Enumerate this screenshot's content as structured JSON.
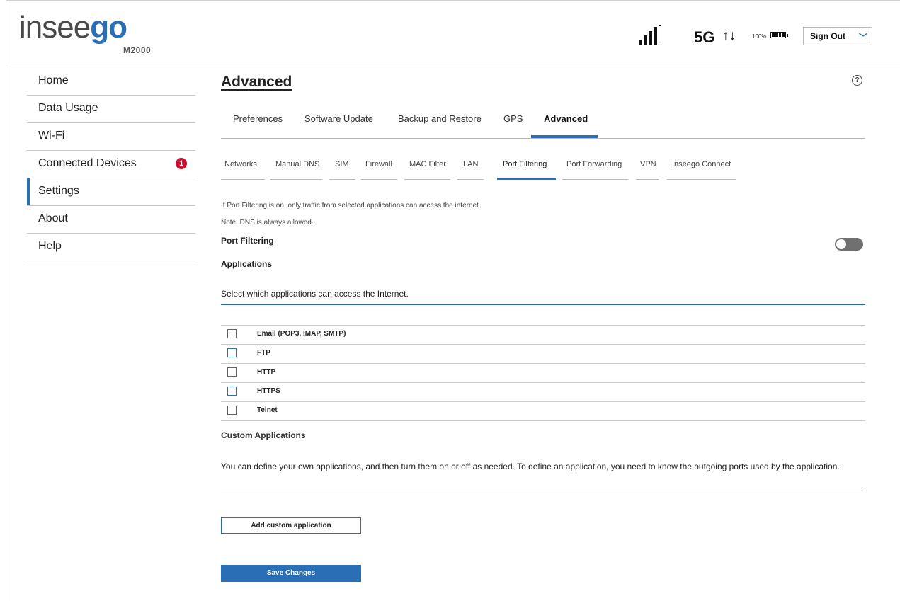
{
  "header": {
    "logo_part1": "insee",
    "logo_part2": "go",
    "model": "M2000",
    "network": "5G",
    "arrows": "↑↓",
    "battery_percent": "100%",
    "sign_out_label": "Sign Out"
  },
  "sidebar": {
    "items": [
      {
        "label": "Home"
      },
      {
        "label": "Data Usage"
      },
      {
        "label": "Wi-Fi"
      },
      {
        "label": "Connected Devices",
        "badge": "1"
      },
      {
        "label": "Settings",
        "active": true
      },
      {
        "label": "About"
      },
      {
        "label": "Help"
      }
    ]
  },
  "main": {
    "title": "Advanced",
    "help_symbol": "?",
    "tabs": [
      "Preferences",
      "Software Update",
      "Backup and Restore",
      "GPS",
      "Advanced"
    ],
    "active_tab": "Advanced",
    "subtabs": [
      "Networks",
      "Manual DNS",
      "SIM",
      "Firewall",
      "MAC Filter",
      "LAN",
      "Port Filtering",
      "Port Forwarding",
      "VPN",
      "Inseego Connect"
    ],
    "active_subtab": "Port Filtering",
    "intro_text": "If Port Filtering is on, only traffic from selected applications can access the internet.",
    "note_text": "Note: DNS is always allowed.",
    "port_filtering_label": "Port Filtering",
    "port_filtering_on": false,
    "applications_label": "Applications",
    "select_text": "Select which applications can access the Internet.",
    "applications": [
      {
        "name": "Email (POP3, IMAP, SMTP)",
        "checked": false
      },
      {
        "name": "FTP",
        "checked": false
      },
      {
        "name": "HTTP",
        "checked": false
      },
      {
        "name": "HTTPS",
        "checked": false
      },
      {
        "name": "Telnet",
        "checked": false
      }
    ],
    "custom_title": "Custom Applications",
    "custom_text": "You can define your own applications, and then turn them on or off as needed. To define an application, you need to know the outgoing ports used by the application.",
    "add_button_label": "Add custom application",
    "save_button_label": "Save Changes"
  },
  "colors": {
    "accent": "#2a6fb5",
    "badge": "#c8102e",
    "toggle_off": "#707070"
  }
}
